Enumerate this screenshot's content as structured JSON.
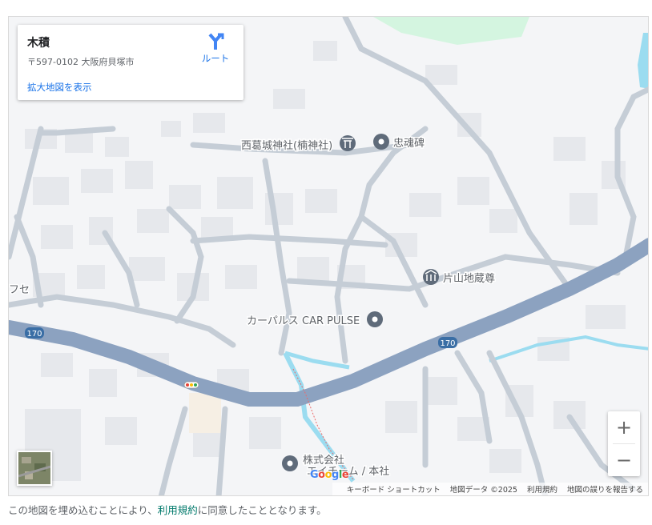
{
  "place": {
    "name": "木積",
    "address": "〒597-0102 大阪府貝塚市",
    "larger_map_link": "拡大地図を表示",
    "route_label": "ルート"
  },
  "map": {
    "pois": [
      {
        "name": "西葛城神社(楠神社)",
        "icon": "shrine-icon"
      },
      {
        "name": "忠魂碑",
        "icon": "place-pin-icon"
      },
      {
        "name": "片山地蔵尊",
        "icon": "temple-icon"
      },
      {
        "name": "カーパルス CAR PULSE",
        "icon": "place-pin-icon"
      },
      {
        "name": "株式会社",
        "icon": "place-pin-icon"
      },
      {
        "name": "エイチーム / 本社",
        "icon": ""
      }
    ],
    "edge_label": "フセ",
    "route_shields": [
      "170",
      "170"
    ],
    "colors": {
      "road": "#c5cdd6",
      "highway": "#8ca2c0",
      "water": "#9bdcf0",
      "park": "#d4f5e0",
      "building": "#e6e8ec"
    }
  },
  "zoom": {
    "in_label": "+",
    "out_label": "−"
  },
  "attribution": {
    "logo": "Google",
    "items": [
      "キーボード ショートカット",
      "地図データ ©2025",
      "利用規約",
      "地図の誤りを報告する"
    ]
  },
  "footer": {
    "prefix": "この地図を埋め込むことにより、",
    "link": "利用規約",
    "suffix": "に同意したこととなります。"
  }
}
